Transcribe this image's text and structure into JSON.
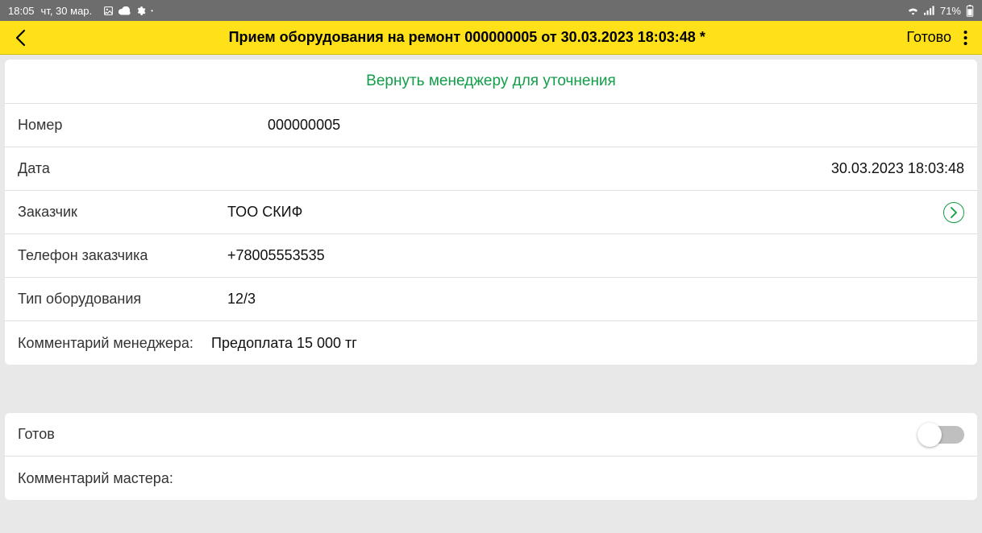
{
  "statusbar": {
    "time": "18:05",
    "date": "чт, 30 мар.",
    "battery": "71%"
  },
  "appbar": {
    "title": "Прием оборудования на ремонт 000000005 от 30.03.2023 18:03:48 *",
    "done_label": "Готово"
  },
  "return_link": "Вернуть менеджеру для уточнения",
  "fields": {
    "number": {
      "label": "Номер",
      "value": "000000005"
    },
    "date": {
      "label": "Дата",
      "value": "30.03.2023 18:03:48"
    },
    "customer": {
      "label": "Заказчик",
      "value": "ТОО СКИФ"
    },
    "phone": {
      "label": "Телефон заказчика",
      "value": "+78005553535"
    },
    "equip_type": {
      "label": "Тип оборудования",
      "value": "12/3"
    },
    "mgr_comment": {
      "label": "Комментарий менеджера:",
      "value": "Предоплата 15 000 тг"
    }
  },
  "section2": {
    "ready": {
      "label": "Готов",
      "checked": false
    },
    "master_comment": {
      "label": "Комментарий мастера:",
      "value": ""
    }
  }
}
